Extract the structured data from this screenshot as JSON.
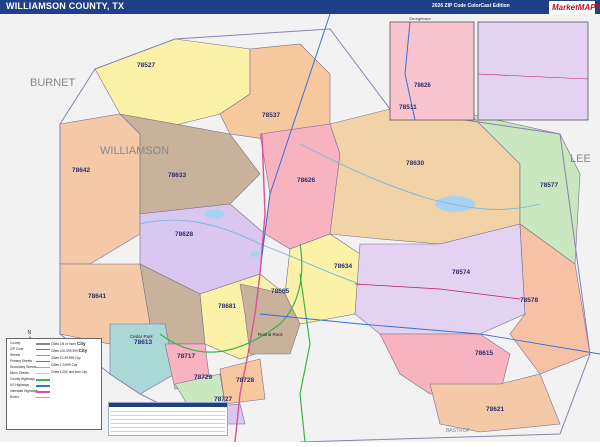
{
  "header": {
    "title": "WILLIAMSON COUNTY, TX",
    "edition": "2026 ZIP Code ColorCast Edition",
    "brand": "MarketMAPS"
  },
  "map": {
    "counties": [
      {
        "name": "BURNET"
      },
      {
        "name": "WILLIAMSON"
      },
      {
        "name": "LEE"
      },
      {
        "name": "BASTROP"
      }
    ],
    "zip_labels": [
      {
        "zip": "78527"
      },
      {
        "zip": "78537"
      },
      {
        "zip": "78642"
      },
      {
        "zip": "78633"
      },
      {
        "zip": "78626"
      },
      {
        "zip": "78630"
      },
      {
        "zip": "78577"
      },
      {
        "zip": "78628"
      },
      {
        "zip": "78634"
      },
      {
        "zip": "78574"
      },
      {
        "zip": "78578"
      },
      {
        "zip": "78641"
      },
      {
        "zip": "78681"
      },
      {
        "zip": "78665"
      },
      {
        "zip": "78613"
      },
      {
        "zip": "78717"
      },
      {
        "zip": "78729"
      },
      {
        "zip": "78728"
      },
      {
        "zip": "78727"
      },
      {
        "zip": "78615"
      },
      {
        "zip": "78621"
      },
      {
        "zip": "78511"
      }
    ],
    "inset_labels": [
      {
        "zip": "78626"
      },
      {
        "zip": "Georgetown"
      }
    ],
    "city_labels": [
      {
        "name": "Cedar Park"
      },
      {
        "name": "Round Rock"
      }
    ],
    "compass": "N"
  },
  "legend": {
    "rows": [
      {
        "label": "County"
      },
      {
        "label": "ZIP Code"
      },
      {
        "label": "Streets"
      },
      {
        "label": "Primary Streets"
      },
      {
        "label": "Secondary Streets"
      },
      {
        "label": "Minor Streets"
      },
      {
        "label": "County Highways"
      },
      {
        "label": "US Highways"
      },
      {
        "label": "Interstate Highways"
      },
      {
        "label": "Rivers"
      }
    ],
    "city_rows": [
      {
        "label": "Cities 1M or more",
        "sample": "City"
      },
      {
        "label": "Cities 100-999,999",
        "sample": "City"
      },
      {
        "label": "Cities 10-99,999",
        "sample": "City"
      },
      {
        "label": "Cities 1-9,999",
        "sample": "City"
      },
      {
        "label": "Cities 1,000 and less",
        "sample": "City"
      }
    ]
  },
  "colors": {
    "title_bar": "#1f3f86",
    "water": "#a7d3f0",
    "us_highway": "#3a6fd8",
    "county_highway": "#39b54a",
    "interstate": "#e0509a"
  }
}
